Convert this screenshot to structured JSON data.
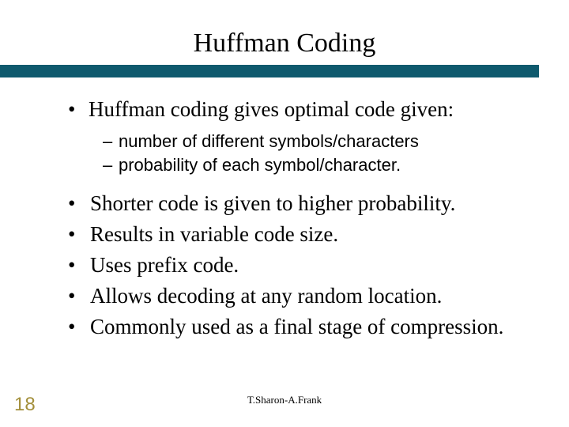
{
  "title": "Huffman Coding",
  "bullets": {
    "intro": "Huffman coding gives optimal code given:",
    "sub": [
      "number of different symbols/characters",
      "probability of each symbol/character."
    ],
    "main": [
      "Shorter code is given to higher probability.",
      "Results in variable code size.",
      "Uses prefix code.",
      "Allows decoding at any random location.",
      "Commonly used as a final stage of compression."
    ]
  },
  "footer": {
    "author": "T.Sharon-A.Frank",
    "slide_number": "18"
  },
  "glyphs": {
    "bullet": "•",
    "dash": "–"
  }
}
